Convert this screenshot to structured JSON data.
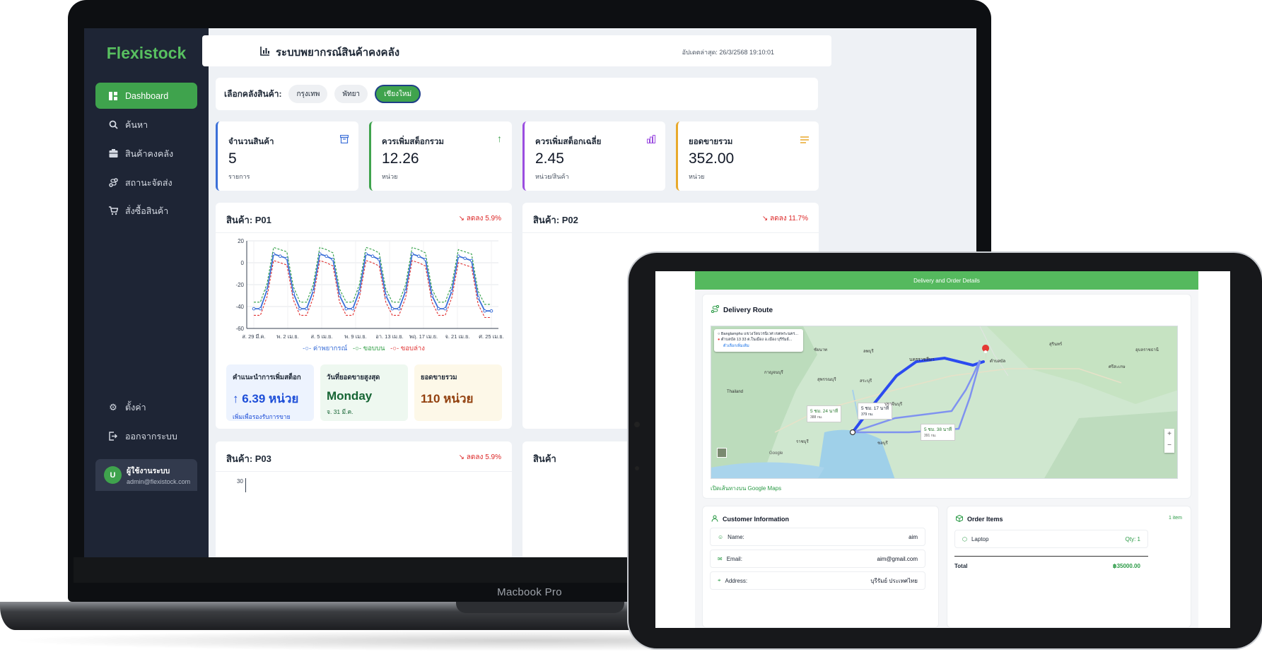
{
  "laptop": {
    "model": "Macbook Pro",
    "app": {
      "brand": "Flexistock",
      "nav": [
        {
          "label": "Dashboard",
          "icon": "dashboard-icon",
          "active": true
        },
        {
          "label": "ค้นหา",
          "icon": "search-icon"
        },
        {
          "label": "สินค้าคงคลัง",
          "icon": "inventory-icon"
        },
        {
          "label": "สถานะจัดส่ง",
          "icon": "delivery-icon"
        },
        {
          "label": "สั่งซื้อสินค้า",
          "icon": "cart-icon"
        }
      ],
      "bottom_nav": [
        {
          "label": "ตั้งค่า",
          "icon": "gear-icon"
        },
        {
          "label": "ออกจากระบบ",
          "icon": "logout-icon"
        }
      ],
      "user": {
        "initial": "U",
        "name": "ผู้ใช้งานระบบ",
        "email": "admin@flexistock.com"
      },
      "header": {
        "title": "ระบบพยากรณ์สินค้าคงคลัง",
        "updated": "อัปเดตล่าสุด: 26/3/2568 19:10:01"
      },
      "warehouse": {
        "label": "เลือกคลังสินค้า:",
        "options": [
          "กรุงเทพ",
          "พัทยา",
          "เชียงใหม่"
        ],
        "selected": "เชียงใหม่"
      },
      "stats": [
        {
          "label": "จำนวนสินค้า",
          "value": "5",
          "unit": "รายการ",
          "color": "#3b6fd8",
          "icon": "archive-icon"
        },
        {
          "label": "ควรเพิ่มสต็อกรวม",
          "value": "12.26",
          "unit": "หน่วย",
          "color": "#3fa34d",
          "icon": "arrow-up-icon"
        },
        {
          "label": "ควรเพิ่มสต็อกเฉลี่ย",
          "value": "2.45",
          "unit": "หน่วย/สินค้า",
          "color": "#9b4de0",
          "icon": "bar-chart-icon"
        },
        {
          "label": "ยอดขายรวม",
          "value": "352.00",
          "unit": "หน่วย",
          "color": "#e8a92b",
          "icon": "list-icon"
        }
      ],
      "products": [
        {
          "title": "สินค้า: P01",
          "change": "↘ ลดลง 5.9%"
        },
        {
          "title": "สินค้า: P02",
          "change": "↘ ลดลง 11.7%"
        },
        {
          "title": "สินค้า: P03",
          "change": "↘ ลดลง 5.9%"
        },
        {
          "title": "สินค้า"
        }
      ],
      "p01_summary": [
        {
          "title": "คำแนะนำการเพิ่มสต็อก",
          "value": "↑ 6.39 หน่วย",
          "sub": "เพิ่มเพื่อรองรับการขาย",
          "color": "#1d4ed8",
          "bg": "#edf3fe"
        },
        {
          "title": "วันที่ยอดขายสูงสุด",
          "value": "Monday",
          "sub": "จ. 31 มี.ค.",
          "color": "#166534",
          "bg": "#eef8f0"
        },
        {
          "title": "ยอดขายรวม",
          "value": "110 หน่วย",
          "sub": "",
          "color": "#92400e",
          "bg": "#fdf8e8"
        }
      ],
      "p03_chart_ytick": "30"
    }
  },
  "chart_data": {
    "type": "line",
    "x_ticks": [
      "ส. 29 มี.ค.",
      "พ. 2 เม.ย.",
      "ส. 5 เม.ย.",
      "พ. 9 เม.ย.",
      "อา. 13 เม.ย.",
      "พฤ. 17 เม.ย.",
      "จ. 21 เม.ย.",
      "ศ. 25 เม.ย."
    ],
    "ylim": [
      -60,
      20
    ],
    "y_ticks": [
      20,
      0,
      -20,
      -40,
      -60
    ],
    "grid": true,
    "legend_position": "bottom",
    "series": [
      {
        "name": "ค่าพยากรณ์",
        "color": "#3b6fd8",
        "values": [
          -42,
          -42,
          -25,
          8,
          6,
          4,
          -28,
          -42,
          -42,
          -26,
          8,
          6,
          3,
          -30,
          -42,
          -42,
          -26,
          8,
          6,
          3,
          -30,
          -42,
          -42,
          -26,
          8,
          6,
          3,
          -30,
          -42,
          -42,
          -26,
          6,
          4,
          2,
          -32,
          -44,
          -44
        ]
      },
      {
        "name": "ขอบบน",
        "color": "#2f9e44",
        "values": [
          -36,
          -36,
          -19,
          14,
          12,
          10,
          -22,
          -36,
          -36,
          -20,
          14,
          12,
          9,
          -24,
          -36,
          -36,
          -20,
          14,
          12,
          9,
          -24,
          -36,
          -36,
          -20,
          14,
          12,
          9,
          -24,
          -36,
          -36,
          -20,
          12,
          10,
          8,
          -26,
          -38,
          -38
        ]
      },
      {
        "name": "ขอบล่าง",
        "color": "#e03131",
        "values": [
          -48,
          -48,
          -31,
          2,
          0,
          -2,
          -34,
          -48,
          -48,
          -32,
          2,
          0,
          -3,
          -36,
          -48,
          -48,
          -32,
          2,
          0,
          -3,
          -36,
          -48,
          -48,
          -32,
          2,
          0,
          -3,
          -36,
          -48,
          -48,
          -32,
          0,
          -2,
          -4,
          -38,
          -50,
          -50
        ]
      }
    ]
  },
  "tablet": {
    "header": "Delivery and Order Details",
    "route": {
      "title": "Delivery Route",
      "origin": "Banglamphu แขวงวัดบวรนิเวศ เขตพระนคร...",
      "destination": "ตำบลบัล 13 33 ต.ในเมือง อ.เมือง บุรีรัมย์...",
      "more_options": "ตัวเลือกเพิ่มเติม",
      "dest_label": "ตำบลบัล",
      "routes": [
        {
          "label": "5 ชม. 17 นาที",
          "dist": "379 กม."
        },
        {
          "label": "5 ชม. 24 นาที",
          "dist": "388 กม."
        },
        {
          "label": "5 ชม. 38 นาที",
          "dist": "391 กม."
        }
      ],
      "places": [
        "นครราชสีมา",
        "ลพบุรี",
        "สระบุรี",
        "ชัยนาท",
        "สุพรรณบุรี",
        "กาญจนบุรี",
        "ปราจีนบุรี",
        "ชลบุรี",
        "ราชบุรี",
        "สุรินทร์",
        "อุบลราชธานี",
        "ศรีสะเกษ",
        "Thailand"
      ],
      "open_link": "เปิดเส้นทางบน Google Maps",
      "attribution": "Google"
    },
    "customer": {
      "title": "Customer Information",
      "rows": [
        {
          "label": "Name:",
          "value": "aim",
          "icon": "user-icon"
        },
        {
          "label": "Email:",
          "value": "aim@gmail.com",
          "icon": "mail-icon"
        },
        {
          "label": "Address:",
          "value": "บุรีรัมย์ ประเทศไทย",
          "icon": "pin-icon"
        }
      ]
    },
    "order": {
      "title": "Order Items",
      "count": "1 item",
      "items": [
        {
          "name": "Laptop",
          "qty": "Qty: 1"
        }
      ],
      "total_label": "Total",
      "total_value": "฿35000.00"
    }
  }
}
